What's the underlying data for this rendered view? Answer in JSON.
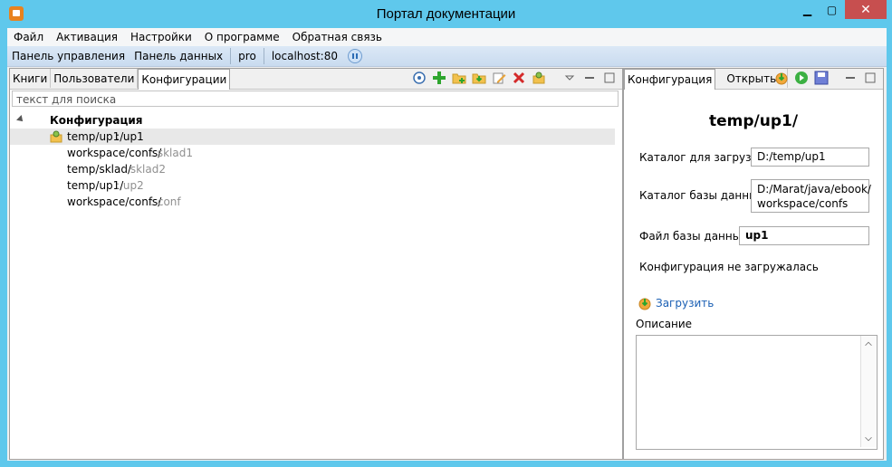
{
  "window": {
    "title": "Портал документации",
    "min_label": "▁",
    "max_label": "▢",
    "close_label": "✕"
  },
  "menu": {
    "items": [
      "Файл",
      "Активация",
      "Настройки",
      "О программе",
      "Обратная связь"
    ]
  },
  "toolbar": {
    "control_panel": "Панель управления",
    "data_panel": "Панель данных",
    "pro": "pro",
    "server": "localhost:80"
  },
  "left": {
    "tabs": [
      "Книги",
      "Пользователи",
      "Конфигурации"
    ],
    "search_placeholder": "текст для поиска",
    "tree": {
      "root": "Конфигурация",
      "items": [
        {
          "path": "temp/up1/",
          "name": " : up1"
        },
        {
          "path": "workspace/confs/",
          "name": " : sklad1"
        },
        {
          "path": "temp/sklad/",
          "name": " : sklad2"
        },
        {
          "path": "temp/up1/",
          "name": " : up2"
        },
        {
          "path": "workspace/confs/",
          "name": " : conf"
        }
      ]
    }
  },
  "right": {
    "tabs": [
      "Конфигурация",
      "Открыть"
    ],
    "title": "temp/up1/",
    "load_dir_label": "Каталог для загрузки:",
    "load_dir_value": "D:/temp/up1",
    "db_dir_label": "Каталог базы данных:",
    "db_dir_value_line1": "D:/Marat/java/ebook/",
    "db_dir_value_line2": "workspace/confs",
    "db_file_label": "Файл базы данных:",
    "db_file_value": "up1",
    "status": "Конфигурация не загружалась",
    "load_link": "Загрузить",
    "description_label": "Описание"
  }
}
